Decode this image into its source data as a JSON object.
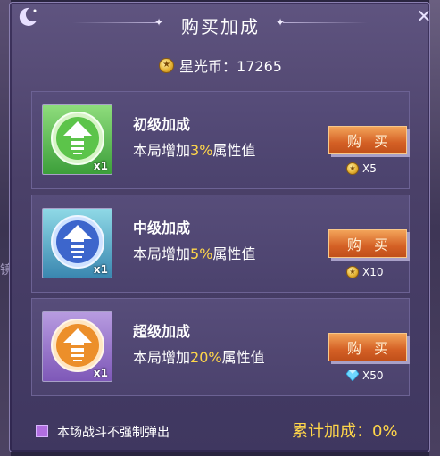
{
  "dialog": {
    "title": "购买加成",
    "close_icon": "close-icon",
    "currency": {
      "label": "星光币：17265",
      "icon": "coin-icon"
    }
  },
  "items": [
    {
      "name": "初级加成",
      "desc_prefix": "本局增加",
      "desc_value": "3%",
      "desc_suffix": "属性值",
      "qty": "x1",
      "buy_label": "购买",
      "price": "X5",
      "price_icon": "coin-icon",
      "color": "#4caf48"
    },
    {
      "name": "中级加成",
      "desc_prefix": "本局增加",
      "desc_value": "5%",
      "desc_suffix": "属性值",
      "qty": "x1",
      "buy_label": "购买",
      "price": "X10",
      "price_icon": "coin-icon",
      "color": "#3a6fd0"
    },
    {
      "name": "超级加成",
      "desc_prefix": "本局增加",
      "desc_value": "20%",
      "desc_suffix": "属性值",
      "qty": "x1",
      "buy_label": "购买",
      "price": "X50",
      "price_icon": "diamond-icon",
      "color": "#e8902a"
    }
  ],
  "footer": {
    "checkbox_label": "本场战斗不强制弹出",
    "checkbox_checked": true,
    "total": "累计加成：0%"
  },
  "background": {
    "side_text": "镜"
  }
}
